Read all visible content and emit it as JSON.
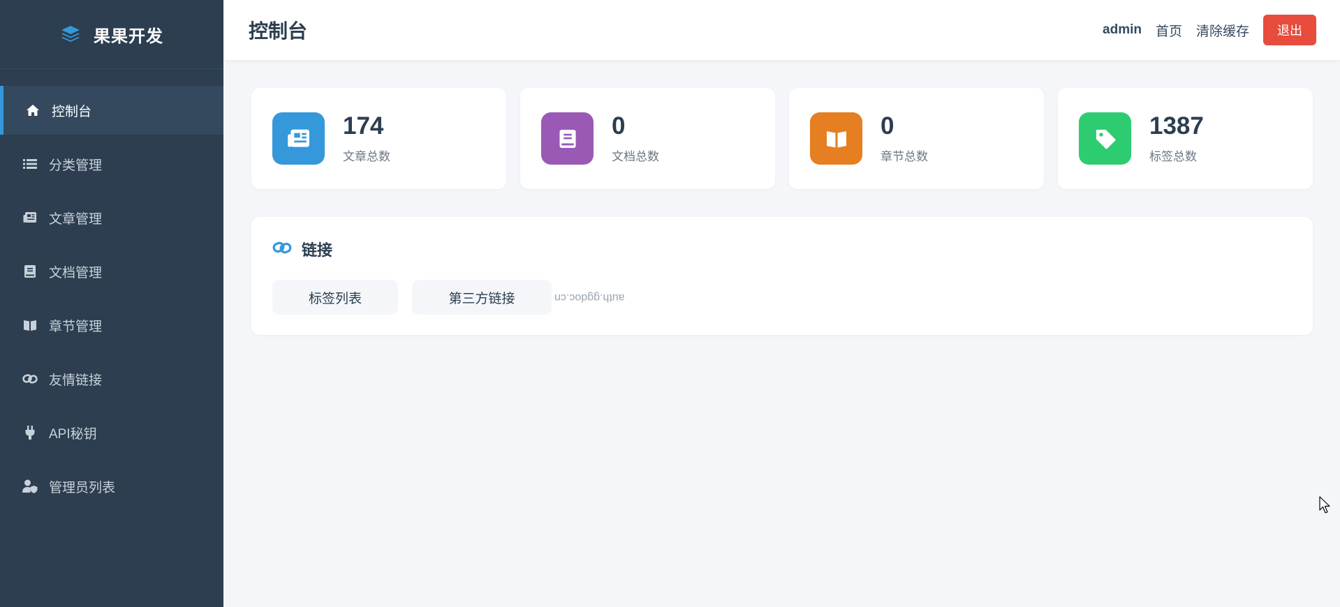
{
  "brand": {
    "name": "果果开发",
    "icon": "layers-icon",
    "icon_color": "#3498db"
  },
  "sidebar": {
    "items": [
      {
        "label": "控制台",
        "icon": "home-icon",
        "active": true
      },
      {
        "label": "分类管理",
        "icon": "list-icon"
      },
      {
        "label": "文章管理",
        "icon": "newspaper-icon"
      },
      {
        "label": "文档管理",
        "icon": "book-icon"
      },
      {
        "label": "章节管理",
        "icon": "book-open-icon"
      },
      {
        "label": "友情链接",
        "icon": "link-icon"
      },
      {
        "label": "API秘钥",
        "icon": "plug-icon"
      },
      {
        "label": "管理员列表",
        "icon": "user-shield-icon"
      }
    ]
  },
  "header": {
    "title": "控制台",
    "user": "admin",
    "home_link": "首页",
    "clear_cache": "清除缓存",
    "logout": "退出"
  },
  "stats": [
    {
      "value": "174",
      "label": "文章总数",
      "icon": "newspaper-icon",
      "color": "#3498db"
    },
    {
      "value": "0",
      "label": "文档总数",
      "icon": "book-icon",
      "color": "#9b59b6"
    },
    {
      "value": "0",
      "label": "章节总数",
      "icon": "book-open-icon",
      "color": "#e67e22"
    },
    {
      "value": "1387",
      "label": "标签总数",
      "icon": "tag-icon",
      "color": "#2ecc71"
    }
  ],
  "links_panel": {
    "title": "链接",
    "icon": "link-icon",
    "buttons": [
      "标签列表",
      "第三方链接"
    ],
    "mirrored_text": "auth.ggdoc.cn"
  },
  "colors": {
    "sidebar_bg": "#2c3e50",
    "accent": "#3498db",
    "danger": "#e74c3c",
    "page_bg": "#f4f6f9"
  }
}
